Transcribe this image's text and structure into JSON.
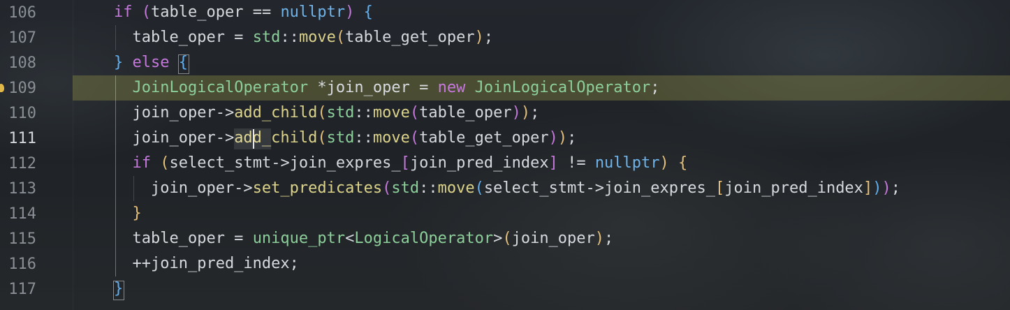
{
  "editor": {
    "lines": [
      {
        "num": "106",
        "tokens": [
          {
            "t": "if",
            "c": "kw"
          },
          {
            "t": " ",
            "c": "id"
          },
          {
            "t": "(",
            "c": "b2"
          },
          {
            "t": "table_oper == ",
            "c": "id"
          },
          {
            "t": "nullptr",
            "c": "nul"
          },
          {
            "t": ")",
            "c": "b2"
          },
          {
            "t": " ",
            "c": "id"
          },
          {
            "t": "{",
            "c": "b3"
          }
        ]
      },
      {
        "num": "107",
        "tokens": [
          {
            "t": "  table_oper = ",
            "c": "id"
          },
          {
            "t": "std",
            "c": "ns"
          },
          {
            "t": "::",
            "c": "op"
          },
          {
            "t": "move",
            "c": "fn"
          },
          {
            "t": "(",
            "c": "b1"
          },
          {
            "t": "table_get_oper",
            "c": "id"
          },
          {
            "t": ")",
            "c": "b1"
          },
          {
            "t": ";",
            "c": "op"
          }
        ]
      },
      {
        "num": "108",
        "tokens": [
          {
            "t": "}",
            "c": "b3"
          },
          {
            "t": " ",
            "c": "id"
          },
          {
            "t": "else",
            "c": "kw"
          },
          {
            "t": " ",
            "c": "id"
          },
          {
            "t": "{",
            "c": "b3"
          }
        ]
      },
      {
        "num": "109",
        "tokens": [
          {
            "t": "  ",
            "c": "id"
          },
          {
            "t": "JoinLogicalOperator",
            "c": "typ"
          },
          {
            "t": " *join_oper = ",
            "c": "id"
          },
          {
            "t": "new",
            "c": "kw"
          },
          {
            "t": " ",
            "c": "id"
          },
          {
            "t": "JoinLogicalOperator",
            "c": "typ"
          },
          {
            "t": ";",
            "c": "op"
          }
        ]
      },
      {
        "num": "110",
        "tokens": [
          {
            "t": "  join_oper->",
            "c": "id"
          },
          {
            "t": "add_child",
            "c": "fn"
          },
          {
            "t": "(",
            "c": "b1"
          },
          {
            "t": "std",
            "c": "ns"
          },
          {
            "t": "::",
            "c": "op"
          },
          {
            "t": "move",
            "c": "fn"
          },
          {
            "t": "(",
            "c": "b2"
          },
          {
            "t": "table_oper",
            "c": "id"
          },
          {
            "t": ")",
            "c": "b2"
          },
          {
            "t": ")",
            "c": "b1"
          },
          {
            "t": ";",
            "c": "op"
          }
        ]
      },
      {
        "num": "111",
        "tokens": [
          {
            "t": "  join_oper->",
            "c": "id"
          },
          {
            "t": "add_child",
            "c": "fn"
          },
          {
            "t": "(",
            "c": "b1"
          },
          {
            "t": "std",
            "c": "ns"
          },
          {
            "t": "::",
            "c": "op"
          },
          {
            "t": "move",
            "c": "fn"
          },
          {
            "t": "(",
            "c": "b2"
          },
          {
            "t": "table_get_oper",
            "c": "id"
          },
          {
            "t": ")",
            "c": "b2"
          },
          {
            "t": ")",
            "c": "b1"
          },
          {
            "t": ";",
            "c": "op"
          }
        ]
      },
      {
        "num": "112",
        "tokens": [
          {
            "t": "  ",
            "c": "id"
          },
          {
            "t": "if",
            "c": "kw"
          },
          {
            "t": " ",
            "c": "id"
          },
          {
            "t": "(",
            "c": "b1"
          },
          {
            "t": "select_stmt->join_expres_",
            "c": "id"
          },
          {
            "t": "[",
            "c": "b2"
          },
          {
            "t": "join_pred_index",
            "c": "id"
          },
          {
            "t": "]",
            "c": "b2"
          },
          {
            "t": " != ",
            "c": "id"
          },
          {
            "t": "nullptr",
            "c": "nul"
          },
          {
            "t": ")",
            "c": "b1"
          },
          {
            "t": " ",
            "c": "id"
          },
          {
            "t": "{",
            "c": "b1"
          }
        ]
      },
      {
        "num": "113",
        "tokens": [
          {
            "t": "    join_oper->",
            "c": "id"
          },
          {
            "t": "set_predicates",
            "c": "fn"
          },
          {
            "t": "(",
            "c": "b2"
          },
          {
            "t": "std",
            "c": "ns"
          },
          {
            "t": "::",
            "c": "op"
          },
          {
            "t": "move",
            "c": "fn"
          },
          {
            "t": "(",
            "c": "b3"
          },
          {
            "t": "select_stmt->join_expres_",
            "c": "id"
          },
          {
            "t": "[",
            "c": "b1"
          },
          {
            "t": "join_pred_index",
            "c": "id"
          },
          {
            "t": "]",
            "c": "b1"
          },
          {
            "t": ")",
            "c": "b3"
          },
          {
            "t": ")",
            "c": "b2"
          },
          {
            "t": ";",
            "c": "op"
          }
        ]
      },
      {
        "num": "114",
        "tokens": [
          {
            "t": "  ",
            "c": "id"
          },
          {
            "t": "}",
            "c": "b1"
          }
        ]
      },
      {
        "num": "115",
        "tokens": [
          {
            "t": "  table_oper = ",
            "c": "id"
          },
          {
            "t": "unique_ptr",
            "c": "ns"
          },
          {
            "t": "<",
            "c": "op"
          },
          {
            "t": "LogicalOperator",
            "c": "typ"
          },
          {
            "t": ">",
            "c": "op"
          },
          {
            "t": "(",
            "c": "b1"
          },
          {
            "t": "join_oper",
            "c": "id"
          },
          {
            "t": ")",
            "c": "b1"
          },
          {
            "t": ";",
            "c": "op"
          }
        ]
      },
      {
        "num": "116",
        "tokens": [
          {
            "t": "  ++join_pred_index;",
            "c": "id"
          }
        ]
      },
      {
        "num": "117",
        "tokens": [
          {
            "t": "}",
            "c": "b3"
          }
        ]
      }
    ],
    "highlighted_line": "109",
    "current_line": "111",
    "lightbulb_line": "109"
  }
}
